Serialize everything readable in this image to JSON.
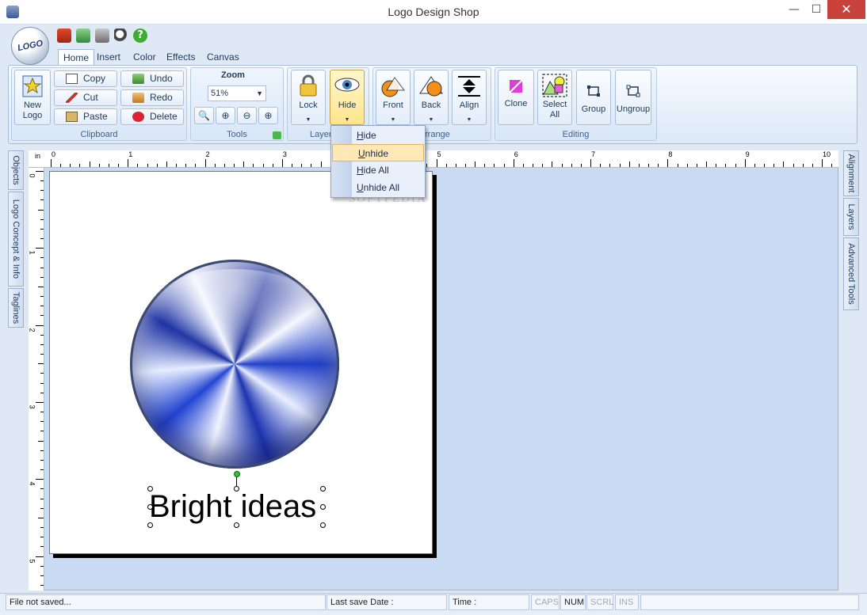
{
  "window": {
    "title": "Logo Design Shop",
    "minimize": "—",
    "maximize": "☐",
    "close": "✕"
  },
  "app_menu": {
    "logo_text": "LOGO"
  },
  "tabs": [
    "Home",
    "Insert",
    "Color",
    "Effects",
    "Canvas"
  ],
  "ribbon": {
    "clipboard": {
      "label": "Clipboard",
      "new_logo": "New\nLogo",
      "copy": "Copy",
      "cut": "Cut",
      "paste": "Paste",
      "undo": "Undo",
      "redo": "Redo",
      "delete": "Delete"
    },
    "tools": {
      "label": "Tools",
      "zoom_title": "Zoom",
      "zoom_value": "51%"
    },
    "layers": {
      "label": "Layer",
      "lock": "Lock",
      "hide": "Hide"
    },
    "arrange": {
      "label": "Arrange",
      "front": "Front",
      "back": "Back",
      "align": "Align"
    },
    "editing": {
      "label": "Editing",
      "clone": "Clone",
      "select_all": "Select\nAll",
      "group": "Group",
      "ungroup": "Ungroup"
    }
  },
  "hide_menu": {
    "items": [
      "Hide",
      "Unhide",
      "Hide All",
      "Unhide All"
    ],
    "highlighted": "Unhide"
  },
  "left_panels": [
    "Objects",
    "Logo Concept & Info",
    "Taglines"
  ],
  "right_panels": [
    "Alignment",
    "Layers",
    "Advanced Tools"
  ],
  "ruler": {
    "unit": "in",
    "marks_top": [
      "0",
      "1",
      "2",
      "3",
      "4",
      "5",
      "6",
      "7",
      "8",
      "9",
      "10"
    ],
    "marks_left": [
      "0",
      "1",
      "2",
      "3",
      "4",
      "5"
    ]
  },
  "canvas": {
    "logo_text": "Bright ideas",
    "watermark": "SOFTPEDIA"
  },
  "status": {
    "file": "File not saved...",
    "last_save": "Last save Date :",
    "time": "Time :",
    "caps": "CAPS",
    "num": "NUM",
    "scrl": "SCRL",
    "ins": "INS"
  }
}
